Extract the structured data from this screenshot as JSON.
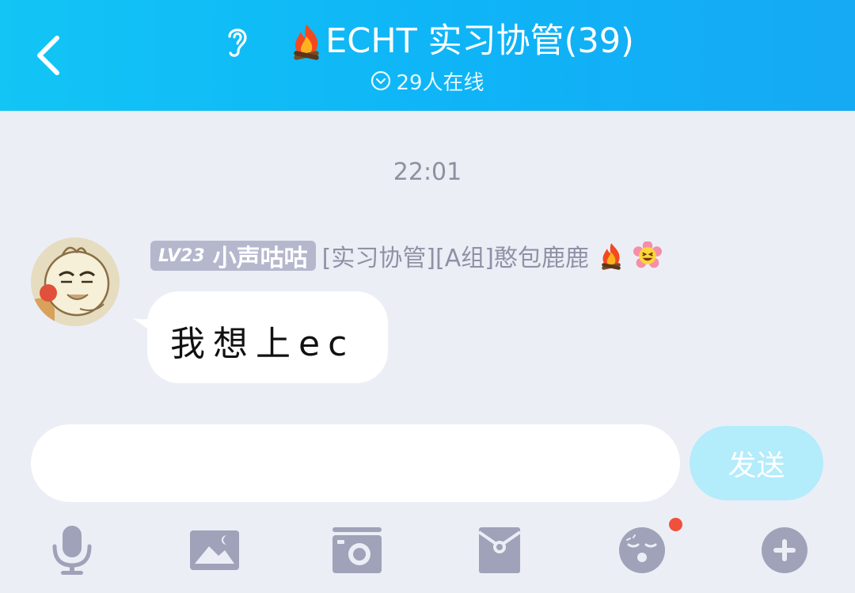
{
  "header": {
    "title": "ECHT 实习协管(39)",
    "online": "29人在线",
    "back_icon": "chevron-left-icon",
    "ear_icon": "ear-icon",
    "title_icon": "campfire-icon",
    "background_color": "#12c5f5"
  },
  "chat": {
    "timestamp": "22:01",
    "messages": [
      {
        "level": "LV23",
        "nickname": "小声咕咕",
        "group_title": "[实习协管][A组]憨包鹿鹿",
        "title_icons": [
          "campfire-icon",
          "grinning-flower-icon"
        ],
        "text": "我想上ec"
      }
    ]
  },
  "input": {
    "value": "",
    "placeholder": ""
  },
  "send_button": {
    "label": "发送",
    "color": "#b3ecfb"
  },
  "toolbar": {
    "items": [
      "microphone-icon",
      "image-icon",
      "camera-icon",
      "red-packet-icon",
      "emoji-icon",
      "plus-icon"
    ],
    "notification_dot_color": "#f0513c"
  }
}
